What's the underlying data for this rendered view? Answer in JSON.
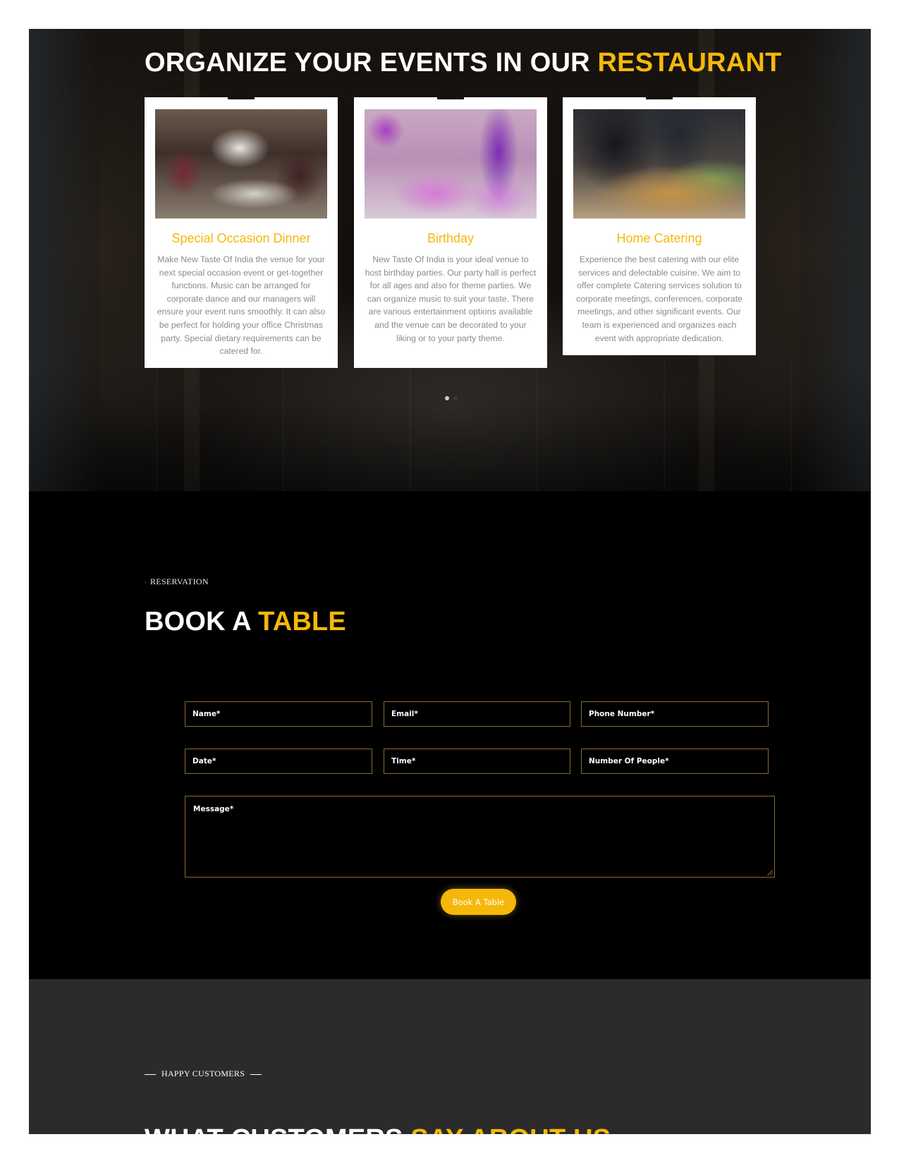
{
  "events": {
    "title_main": "ORGANIZE YOUR EVENTS IN OUR ",
    "title_accent": "RESTAURANT",
    "cards": [
      {
        "title": "Special Occasion Dinner",
        "text": "Make New Taste Of India the venue for your next special occasion event or get-together functions. Music can be arranged for corporate dance and our managers will ensure your event runs smoothly. It can also be perfect for holding your office Christmas party. Special dietary requirements can be catered for."
      },
      {
        "title": "Birthday",
        "text": "New Taste Of India is your ideal venue to host birthday parties. Our party hall is perfect for all ages and also for theme parties. We can organize music to suit your taste. There are various entertainment options available and the venue can be decorated to your liking or to your party theme."
      },
      {
        "title": "Home Catering",
        "text": "Experience the best catering with our elite services and delectable cuisine. We aim to offer complete Catering services solution to corporate meetings, conferences, corporate meetings, and other significant events. Our team is experienced and organizes each event with appropriate dedication."
      }
    ]
  },
  "reservation": {
    "eyebrow": "RESERVATION",
    "title_main": "BOOK A ",
    "title_accent": "TABLE",
    "fields": {
      "name": "Name*",
      "email": "Email*",
      "phone": "Phone Number*",
      "date": "Date*",
      "time": "Time*",
      "people": "Number Of People*",
      "message": "Message*"
    },
    "button_label": "Book A Table"
  },
  "testimonials": {
    "eyebrow": "HAPPY CUSTOMERS",
    "title_main": "WHAT CUSTOMERS ",
    "title_accent": "SAY ABOUT US"
  },
  "colors": {
    "accent": "#f5b80a",
    "field_border": "#8a6a2e",
    "testimonials_bg": "#2b2b2b"
  }
}
